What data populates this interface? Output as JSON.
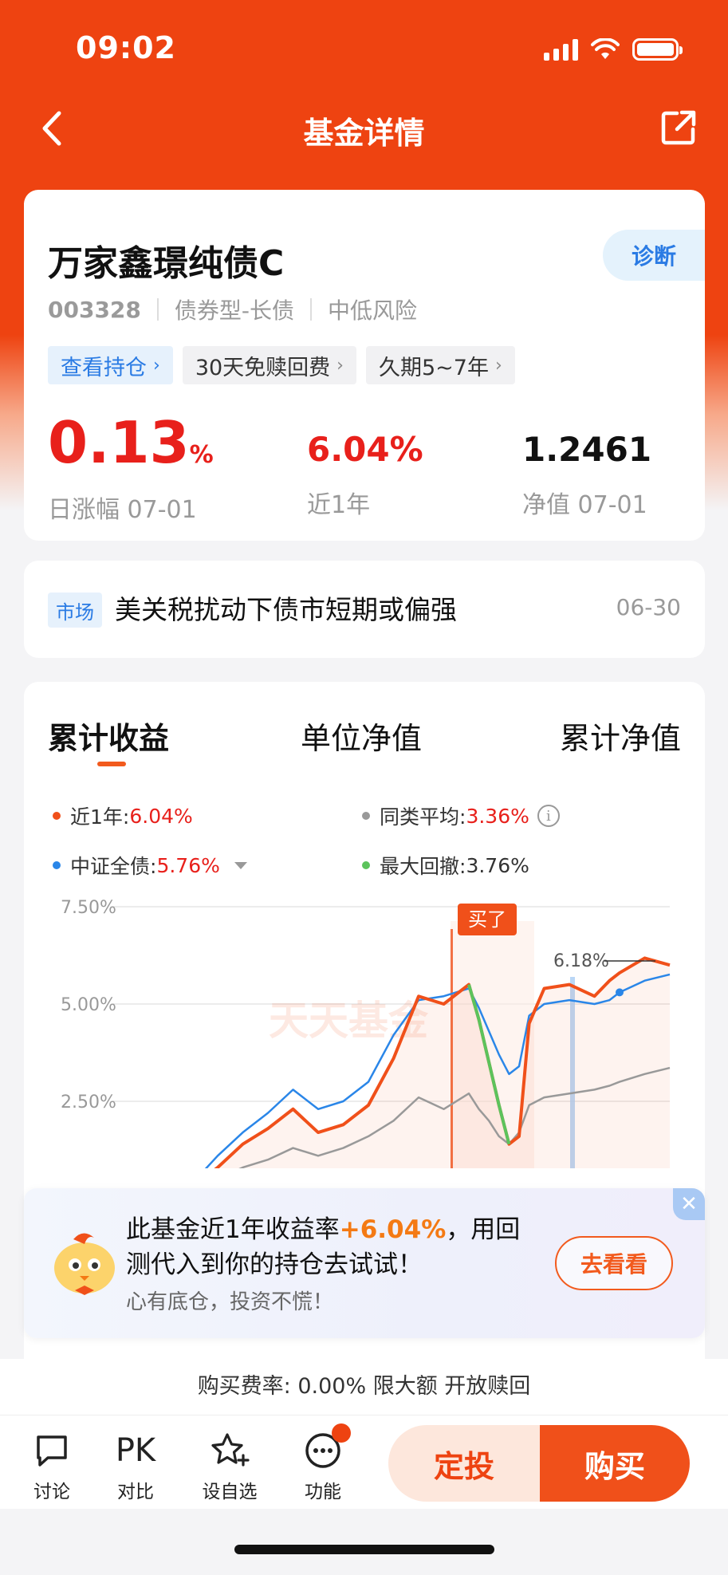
{
  "status_bar": {
    "time": "09:02"
  },
  "nav": {
    "title": "基金详情",
    "back_icon": "chevron-left-icon",
    "share_icon": "share-icon"
  },
  "fund": {
    "name": "万家鑫璟纯债C",
    "diagnose_label": "诊断",
    "code": "003328",
    "type": "债券型-长债",
    "risk": "中低风险",
    "tags": [
      "查看持仓",
      "30天免赎回费",
      "久期5~7年"
    ],
    "daily_change": {
      "value": "0.13",
      "unit": "%",
      "label": "日涨幅 07-01"
    },
    "one_year": {
      "value": "6.04%",
      "label": "近1年"
    },
    "nav_value": {
      "value": "1.2461",
      "label": "净值 07-01"
    }
  },
  "news": {
    "tag": "市场",
    "title": "美关税扰动下债市短期或偏强",
    "date": "06-30"
  },
  "chart_section": {
    "tabs": [
      "累计收益",
      "单位净值",
      "累计净值"
    ],
    "active_tab": 0,
    "legend": [
      {
        "label": "近1年:",
        "value": "6.04%",
        "color": "#f0501a",
        "value_red": true
      },
      {
        "label": "同类平均:",
        "value": "3.36%",
        "color": "#999999",
        "value_red": true
      },
      {
        "label": "中证全债:",
        "value": "5.76%",
        "color": "#2a86e8",
        "value_red": true
      },
      {
        "label": "最大回撤:",
        "value": "3.76%",
        "color": "#5cc35c",
        "value_red": false
      }
    ],
    "bought_label": "买了",
    "peak_label": "6.18%",
    "watermark": "天天基金"
  },
  "chart_data": {
    "type": "line",
    "ylabel": "",
    "xlabel": "",
    "y_ticks": [
      "7.50%",
      "5.00%",
      "2.50%"
    ],
    "ylim": [
      0,
      7.5
    ],
    "grid": true,
    "series": [
      {
        "name": "近1年",
        "color": "#f0501a",
        "x": [
          0,
          5,
          10,
          15,
          20,
          25,
          30,
          35,
          40,
          45,
          50,
          55,
          60,
          62,
          64,
          66,
          68,
          70,
          72,
          75,
          80,
          85,
          88,
          90,
          95,
          100
        ],
        "values": [
          0.0,
          0.3,
          0.8,
          1.4,
          1.8,
          2.3,
          1.7,
          1.9,
          2.4,
          3.6,
          5.2,
          5.0,
          5.5,
          4.6,
          3.5,
          2.4,
          1.4,
          1.6,
          4.5,
          5.4,
          5.5,
          5.2,
          5.6,
          5.8,
          6.18,
          6.0
        ]
      },
      {
        "name": "中证全债",
        "color": "#2a86e8",
        "x": [
          0,
          5,
          10,
          15,
          20,
          25,
          30,
          35,
          40,
          45,
          50,
          55,
          60,
          62,
          64,
          66,
          68,
          70,
          72,
          75,
          80,
          85,
          88,
          90,
          95,
          100
        ],
        "values": [
          0.0,
          0.4,
          1.1,
          1.7,
          2.2,
          2.8,
          2.3,
          2.5,
          3.0,
          4.2,
          5.1,
          5.2,
          5.4,
          4.9,
          4.3,
          3.7,
          3.2,
          3.4,
          4.7,
          5.0,
          5.1,
          5.0,
          5.1,
          5.3,
          5.6,
          5.76
        ]
      },
      {
        "name": "同类平均",
        "color": "#999999",
        "x": [
          0,
          5,
          10,
          15,
          20,
          25,
          30,
          35,
          40,
          45,
          50,
          55,
          60,
          62,
          64,
          66,
          68,
          70,
          72,
          75,
          80,
          85,
          88,
          90,
          95,
          100
        ],
        "values": [
          0.0,
          0.2,
          0.5,
          0.8,
          1.0,
          1.3,
          1.1,
          1.3,
          1.6,
          2.0,
          2.6,
          2.3,
          2.7,
          2.3,
          2.0,
          1.6,
          1.4,
          1.7,
          2.4,
          2.6,
          2.7,
          2.8,
          2.9,
          3.0,
          3.2,
          3.36
        ]
      }
    ]
  },
  "promo": {
    "text_prefix": "此基金近1年收益率",
    "text_highlight": "+6.04%",
    "text_suffix": "，用回测代入到你的持仓去试试！",
    "subtext": "心有底仓，投资不慌！",
    "button": "去看看"
  },
  "fee_bar": {
    "text": "购买费率: 0.00%  限大额  开放赎回"
  },
  "bottom_bar": {
    "items": [
      {
        "label": "讨论",
        "icon": "chat-bubble-icon"
      },
      {
        "label": "对比",
        "icon": "PK"
      },
      {
        "label": "设自选",
        "icon": "star-plus-icon"
      },
      {
        "label": "功能",
        "icon": "more-dots-icon"
      }
    ],
    "sip_label": "定投",
    "buy_label": "购买"
  }
}
